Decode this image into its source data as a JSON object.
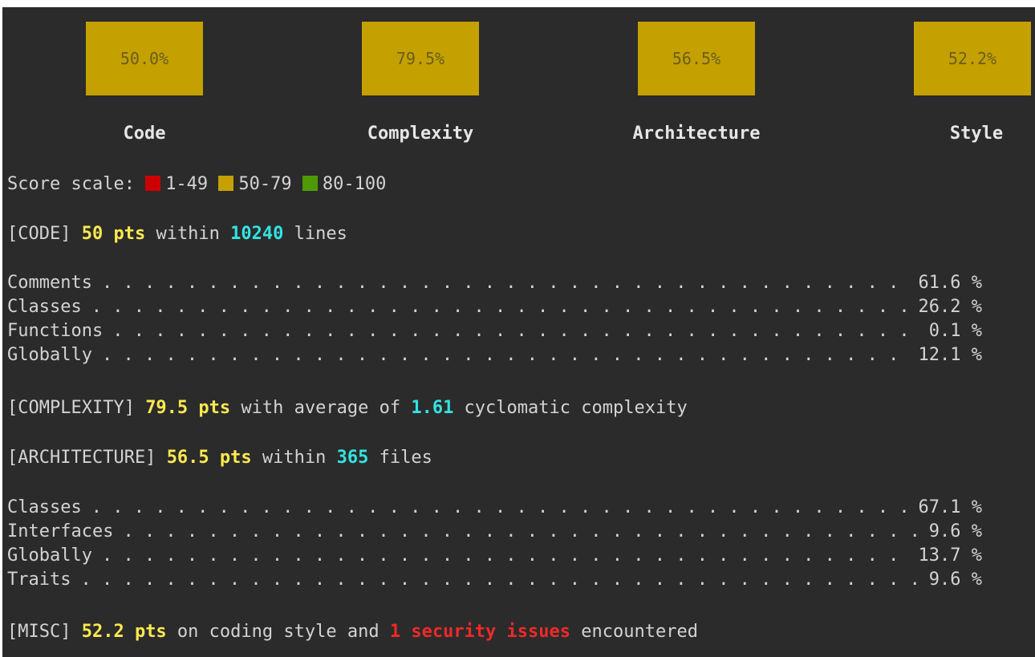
{
  "scores": [
    {
      "value": "50.0%",
      "label": "Code"
    },
    {
      "value": "79.5%",
      "label": "Complexity"
    },
    {
      "value": "56.5%",
      "label": "Architecture"
    },
    {
      "value": "52.2%",
      "label": "Style"
    }
  ],
  "scale": {
    "prefix": "Score scale: ",
    "ranges": [
      {
        "label": "1-49",
        "color": "#cc0000"
      },
      {
        "label": "50-79",
        "color": "#c4a000"
      },
      {
        "label": "80-100",
        "color": "#4e9a06"
      }
    ]
  },
  "code": {
    "tag": "[CODE] ",
    "pts": "50 pts",
    "mid": " within ",
    "lines": "10240",
    "suffix": " lines",
    "metrics": [
      {
        "name": "Comments",
        "value": "61.6 %"
      },
      {
        "name": "Classes",
        "value": "26.2 %"
      },
      {
        "name": "Functions",
        "value": "0.1 %"
      },
      {
        "name": "Globally",
        "value": "12.1 %"
      }
    ]
  },
  "complexity": {
    "tag": "[COMPLEXITY] ",
    "pts": "79.5 pts",
    "mid": " with average of ",
    "avg": "1.61",
    "suffix": " cyclomatic complexity"
  },
  "architecture": {
    "tag": "[ARCHITECTURE] ",
    "pts": "56.5 pts",
    "mid": " within ",
    "files": "365",
    "suffix": " files",
    "metrics": [
      {
        "name": "Classes",
        "value": "67.1 %"
      },
      {
        "name": "Interfaces",
        "value": "9.6 %"
      },
      {
        "name": "Globally",
        "value": "13.7 %"
      },
      {
        "name": "Traits",
        "value": "9.6 %"
      }
    ]
  },
  "misc": {
    "tag": "[MISC] ",
    "pts": "52.2 pts",
    "mid": " on coding style and ",
    "issues": "1 security issues",
    "suffix": " encountered"
  },
  "colors": {
    "background": "#2b2b2b",
    "box": "#c4a000",
    "points": "#fce94f",
    "count": "#34e2e2",
    "issues": "#ef2929"
  }
}
